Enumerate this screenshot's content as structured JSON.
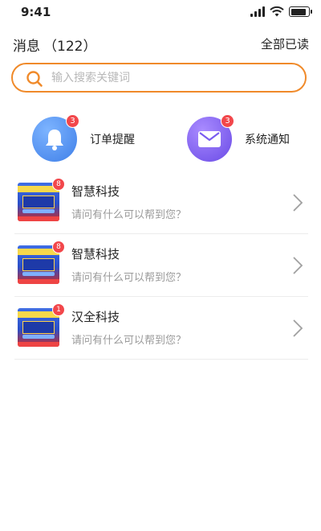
{
  "status": {
    "time": "9:41",
    "battery_level": 0.9
  },
  "header": {
    "title": "消息",
    "count": "（122）",
    "mark_all_read": "全部已读"
  },
  "search": {
    "placeholder": "输入搜索关键词"
  },
  "shortcuts": [
    {
      "icon": "bell-icon",
      "label": "订单提醒",
      "badge": "3",
      "color": "#4a8ff0"
    },
    {
      "icon": "envelope-icon",
      "label": "系统通知",
      "badge": "3",
      "color": "#7a5cf0"
    }
  ],
  "conversations": [
    {
      "name": "智慧科技",
      "preview": "请问有什么可以帮到您？",
      "unread": "8"
    },
    {
      "name": "智慧科技",
      "preview": "请问有什么可以帮到您？",
      "unread": "8"
    },
    {
      "name": "汉全科技",
      "preview": "请问有什么可以帮到您？",
      "unread": "1"
    }
  ],
  "colors": {
    "accent": "#f08a2a",
    "badge": "#f2474b"
  }
}
